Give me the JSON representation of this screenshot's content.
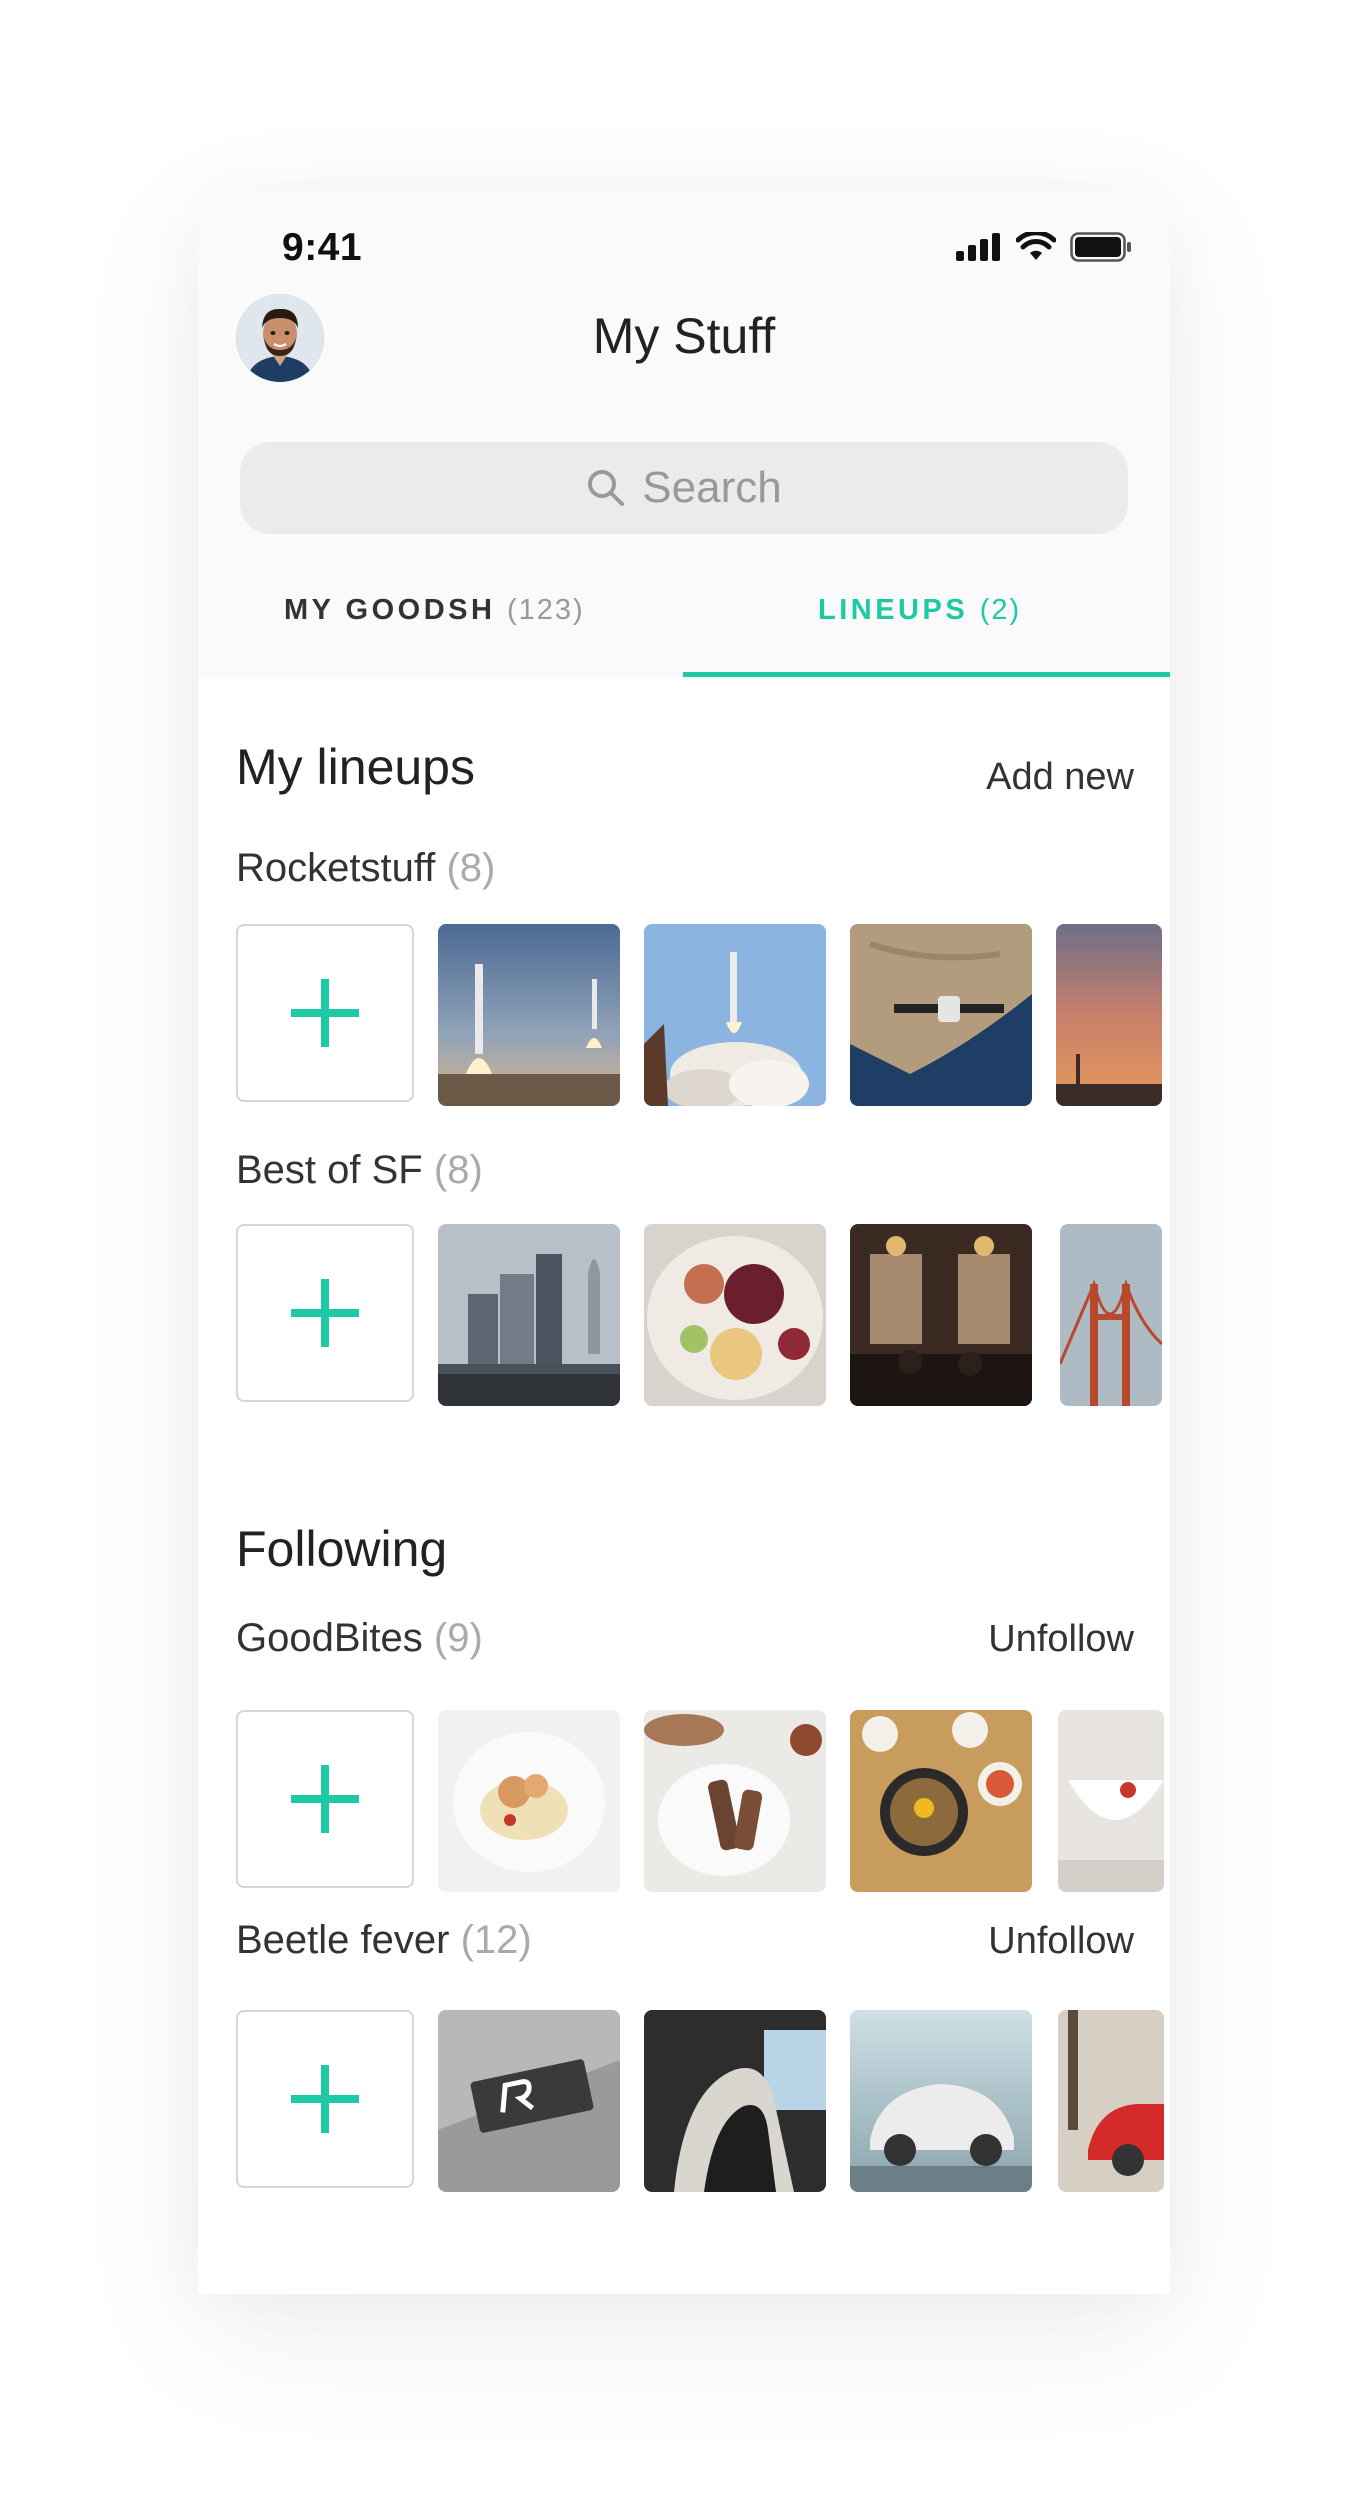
{
  "status_bar": {
    "time": "9:41"
  },
  "header": {
    "title": "My Stuff",
    "search_placeholder": "Search"
  },
  "tabs": [
    {
      "label": "MY GOODSH",
      "count": "(123)",
      "active": false
    },
    {
      "label": "LINEUPS",
      "count": "(2)",
      "active": true
    }
  ],
  "my_lineups": {
    "title": "My lineups",
    "action": "Add new",
    "lineups": [
      {
        "name": "Rocketstuff",
        "count": "(8)"
      },
      {
        "name": "Best of SF",
        "count": "(8)"
      }
    ]
  },
  "following": {
    "title": "Following",
    "lineups": [
      {
        "name": "GoodBites",
        "count": "(9)",
        "action": "Unfollow"
      },
      {
        "name": "Beetle fever",
        "count": "(12)",
        "action": "Unfollow"
      }
    ]
  },
  "colors": {
    "accent": "#1ec9a6",
    "background": "#fafafa",
    "search": "#ebebeb"
  }
}
